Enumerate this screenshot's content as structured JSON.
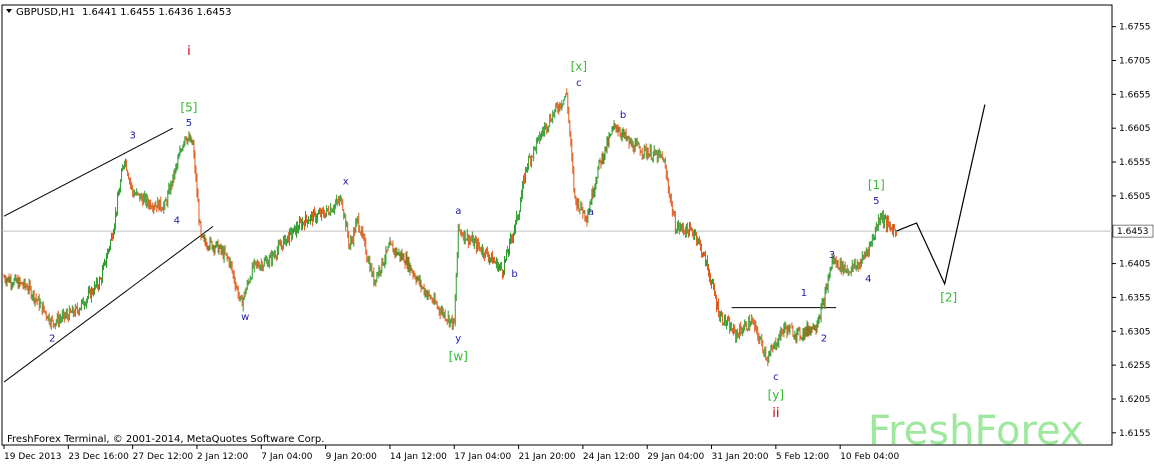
{
  "header": {
    "symbol": "GBPUSD,H1",
    "ohlc": "1.6441 1.6455 1.6436 1.6453"
  },
  "footer": {
    "copyright": "FreshForex Terminal, © 2001-2014, MetaQuotes Software Corp.",
    "watermark": "FreshForex"
  },
  "colors": {
    "bull": "#2a9a2a",
    "bear": "#e05a1a",
    "label_blue": "#1a1aa6",
    "label_green": "#33bb33",
    "label_red": "#cc0000",
    "current_price_box": "#ffffff"
  },
  "chart_data": {
    "type": "line",
    "ylim": [
      1.6137,
      1.6787
    ],
    "y_ticks": [
      "1.6755",
      "1.6705",
      "1.6655",
      "1.6605",
      "1.6555",
      "1.6505",
      "1.6405",
      "1.6355",
      "1.6305",
      "1.6255",
      "1.6205",
      "1.6155"
    ],
    "current_price": "1.6453",
    "x_ticks": [
      "19 Dec 2013",
      "23 Dec 16:00",
      "27 Dec 12:00",
      "2 Jan 12:00",
      "7 Jan 04:00",
      "9 Jan 20:00",
      "14 Jan 12:00",
      "17 Jan 04:00",
      "21 Jan 20:00",
      "24 Jan 12:00",
      "29 Jan 04:00",
      "31 Jan 20:00",
      "5 Feb 12:00",
      "10 Feb 04:00"
    ],
    "x_tick_index": [
      0,
      16,
      32,
      48,
      64,
      80,
      96,
      112,
      128,
      144,
      160,
      176,
      192,
      208
    ],
    "price_path": [
      [
        0,
        1.6385
      ],
      [
        6,
        1.637
      ],
      [
        12,
        1.6318
      ],
      [
        18,
        1.6335
      ],
      [
        24,
        1.638
      ],
      [
        27,
        1.645
      ],
      [
        30,
        1.6562
      ],
      [
        32,
        1.651
      ],
      [
        36,
        1.6495
      ],
      [
        40,
        1.649
      ],
      [
        43,
        1.655
      ],
      [
        45,
        1.6595
      ],
      [
        47,
        1.658
      ],
      [
        49,
        1.644
      ],
      [
        53,
        1.643
      ],
      [
        56,
        1.641
      ],
      [
        59,
        1.6345
      ],
      [
        62,
        1.64
      ],
      [
        66,
        1.641
      ],
      [
        70,
        1.644
      ],
      [
        75,
        1.647
      ],
      [
        80,
        1.648
      ],
      [
        84,
        1.65
      ],
      [
        86,
        1.643
      ],
      [
        88,
        1.647
      ],
      [
        92,
        1.638
      ],
      [
        96,
        1.643
      ],
      [
        100,
        1.641
      ],
      [
        104,
        1.637
      ],
      [
        108,
        1.634
      ],
      [
        112,
        1.6315
      ],
      [
        113,
        1.6455
      ],
      [
        116,
        1.644
      ],
      [
        120,
        1.642
      ],
      [
        124,
        1.6395
      ],
      [
        128,
        1.648
      ],
      [
        130,
        1.655
      ],
      [
        134,
        1.66
      ],
      [
        137,
        1.663
      ],
      [
        140,
        1.6655
      ],
      [
        142,
        1.65
      ],
      [
        145,
        1.6475
      ],
      [
        148,
        1.655
      ],
      [
        152,
        1.661
      ],
      [
        156,
        1.658
      ],
      [
        160,
        1.657
      ],
      [
        164,
        1.656
      ],
      [
        167,
        1.646
      ],
      [
        172,
        1.645
      ],
      [
        175,
        1.64
      ],
      [
        178,
        1.633
      ],
      [
        182,
        1.63
      ],
      [
        186,
        1.632
      ],
      [
        190,
        1.6265
      ],
      [
        194,
        1.631
      ],
      [
        198,
        1.63
      ],
      [
        202,
        1.6315
      ],
      [
        204,
        1.635
      ],
      [
        206,
        1.641
      ],
      [
        210,
        1.6395
      ],
      [
        213,
        1.6405
      ],
      [
        216,
        1.644
      ],
      [
        218,
        1.6478
      ],
      [
        220,
        1.646
      ],
      [
        222,
        1.6453
      ]
    ],
    "projection": [
      [
        222,
        1.6453
      ],
      [
        227,
        1.6465
      ],
      [
        234,
        1.6375
      ],
      [
        244,
        1.664
      ]
    ],
    "trend_lines": [
      [
        [
          0,
          1.6475
        ],
        [
          42,
          1.6605
        ]
      ],
      [
        [
          0,
          1.623
        ],
        [
          52,
          1.646
        ]
      ],
      [
        [
          181,
          1.634
        ],
        [
          207,
          1.634
        ]
      ]
    ],
    "annotations": [
      {
        "text": "i",
        "i": 46,
        "y": 1.6713,
        "color": "red"
      },
      {
        "text": "[5]",
        "i": 46,
        "y": 1.663,
        "color": "green"
      },
      {
        "text": "5",
        "i": 46,
        "y": 1.6608,
        "color": "blue"
      },
      {
        "text": "3",
        "i": 32,
        "y": 1.659,
        "color": "blue"
      },
      {
        "text": "4",
        "i": 43,
        "y": 1.6464,
        "color": "blue"
      },
      {
        "text": "2",
        "i": 12,
        "y": 1.629,
        "color": "blue"
      },
      {
        "text": "w",
        "i": 60,
        "y": 1.6322,
        "color": "blue"
      },
      {
        "text": "x",
        "i": 85,
        "y": 1.6522,
        "color": "blue"
      },
      {
        "text": "a",
        "i": 113,
        "y": 1.6478,
        "color": "blue"
      },
      {
        "text": "b",
        "i": 127,
        "y": 1.6385,
        "color": "blue"
      },
      {
        "text": "y",
        "i": 113,
        "y": 1.629,
        "color": "blue"
      },
      {
        "text": "[w]",
        "i": 113,
        "y": 1.6262,
        "color": "green"
      },
      {
        "text": "[x]",
        "i": 143,
        "y": 1.669,
        "color": "green"
      },
      {
        "text": "c",
        "i": 143,
        "y": 1.6667,
        "color": "blue"
      },
      {
        "text": "b",
        "i": 154,
        "y": 1.662,
        "color": "blue"
      },
      {
        "text": "a",
        "i": 146,
        "y": 1.6477,
        "color": "blue"
      },
      {
        "text": "1",
        "i": 199,
        "y": 1.6357,
        "color": "blue"
      },
      {
        "text": "2",
        "i": 204,
        "y": 1.629,
        "color": "blue"
      },
      {
        "text": "3",
        "i": 206,
        "y": 1.6413,
        "color": "blue"
      },
      {
        "text": "4",
        "i": 215,
        "y": 1.6378,
        "color": "blue"
      },
      {
        "text": "5",
        "i": 217,
        "y": 1.6493,
        "color": "blue"
      },
      {
        "text": "[1]",
        "i": 217,
        "y": 1.6515,
        "color": "green"
      },
      {
        "text": "c",
        "i": 192,
        "y": 1.6233,
        "color": "blue"
      },
      {
        "text": "[y]",
        "i": 192,
        "y": 1.6205,
        "color": "green"
      },
      {
        "text": "ii",
        "i": 192,
        "y": 1.6178,
        "color": "red"
      },
      {
        "text": "[2]",
        "i": 235,
        "y": 1.6349,
        "color": "green"
      }
    ]
  }
}
